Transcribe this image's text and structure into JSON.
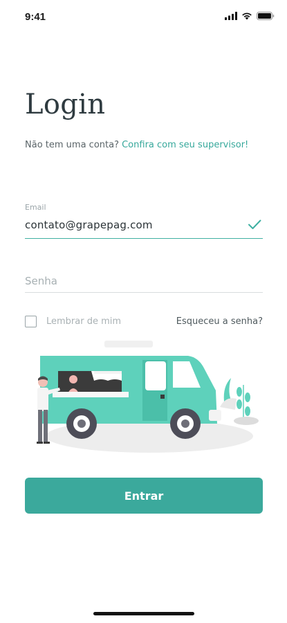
{
  "status_bar": {
    "time": "9:41"
  },
  "login": {
    "title": "Login",
    "subtitle_text": "Não tem uma conta? ",
    "subtitle_link": "Confira com seu supervisor!",
    "email_label": "Email",
    "email_value": "contato@grapepag.com",
    "password_placeholder": "Senha",
    "remember_label": "Lembrar de mim",
    "remember_checked": false,
    "forgot_label": "Esqueceu a senha?",
    "submit_label": "Entrar"
  },
  "colors": {
    "accent": "#3ba99c",
    "text_dark": "#2f3b40",
    "muted": "#a9b1b4"
  },
  "icons": {
    "signal": "cellular-signal-icon",
    "wifi": "wifi-icon",
    "battery": "battery-icon",
    "check": "checkmark-icon"
  }
}
